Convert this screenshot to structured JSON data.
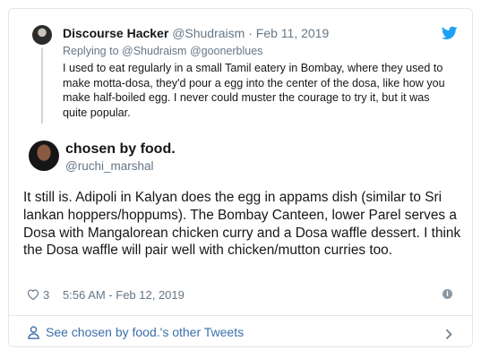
{
  "parent_tweet": {
    "author_name": "Discourse Hacker",
    "author_handle": "@Shudraism",
    "separator": "·",
    "date": "Feb 11, 2019",
    "replying_to_label": "Replying to",
    "replying_to_mentions": "@Shudraism @goonerblues",
    "text": "I used to eat regularly in a small Tamil eatery in Bombay, where they used to make motta-dosa, they'd pour a egg into the center of the dosa, like how you make half-boiled egg. I never could muster the courage to try it, but it was quite popular."
  },
  "main_tweet": {
    "author_name": "chosen by food.",
    "author_handle": "@ruchi_marshal",
    "text": "It still is. Adipoli in Kalyan does the egg in appams dish (similar to Sri lankan hoppers/hoppums). The Bombay Canteen, lower Parel serves a Dosa with Mangalorean chicken curry and a Dosa waffle dessert. I think the Dosa waffle will pair well with chicken/mutton curries too.",
    "like_count": "3",
    "timestamp": "5:56 AM - Feb 12, 2019"
  },
  "footer": {
    "see_more_label": "See chosen by food.'s other Tweets"
  },
  "icons": {
    "twitter": "twitter-bird-icon",
    "like": "heart-icon",
    "info": "info-icon",
    "person": "person-icon",
    "chevron": "chevron-right-icon"
  },
  "colors": {
    "twitter_blue": "#1da1f2",
    "muted": "#657786",
    "link": "#3b6faa",
    "border": "#e1e8ed"
  }
}
